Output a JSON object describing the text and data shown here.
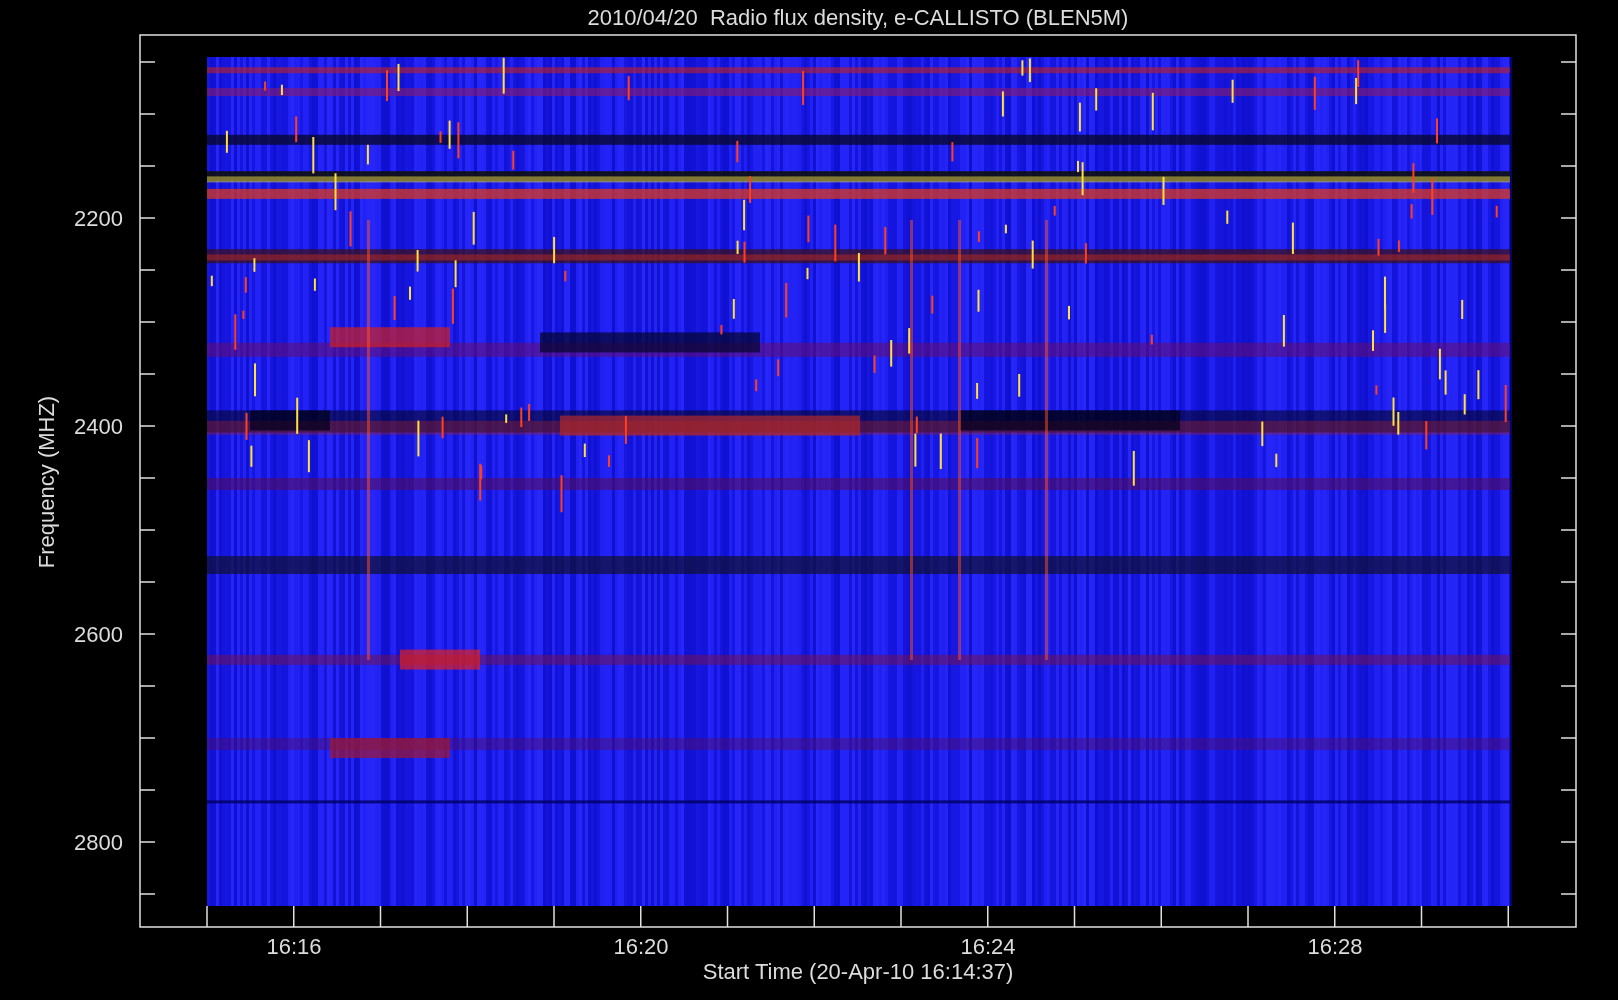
{
  "title": "2010/04/20  Radio flux density, e-CALLISTO (BLEN5M)",
  "ylabel": "Frequency (MHZ)",
  "xlabel": "Start Time (20-Apr-10 16:14:37)",
  "yticks": [
    "2200",
    "2400",
    "2600",
    "2800"
  ],
  "xticks": [
    "16:16",
    "16:20",
    "16:24",
    "16:28"
  ]
}
